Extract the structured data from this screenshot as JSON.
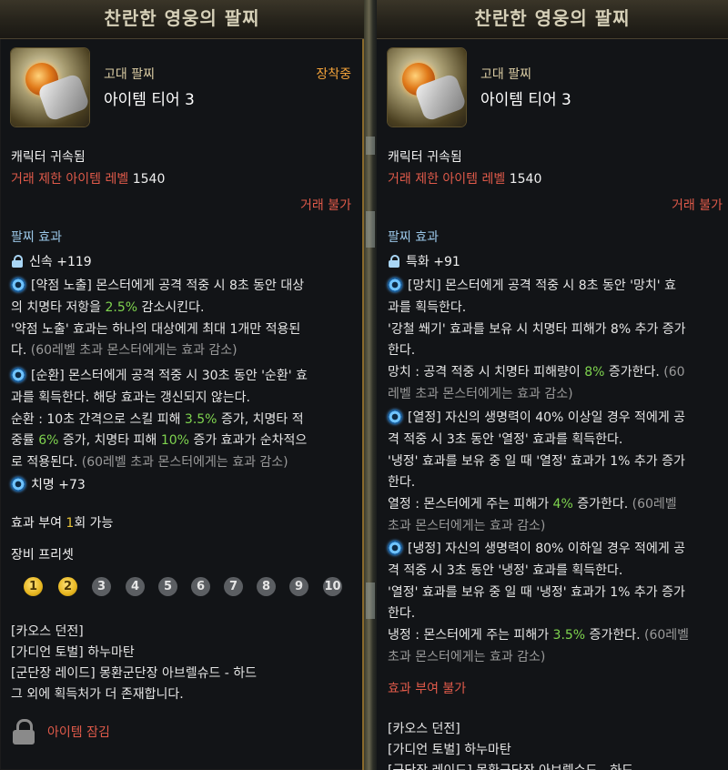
{
  "left": {
    "title": "찬란한 영웅의 팔찌",
    "grade": "고대 팔찌",
    "tier": "아이템 티어 3",
    "equipped": "장착중",
    "bound": "캐릭터 귀속됨",
    "trade_limit_label": "거래 제한 아이템 레벨",
    "trade_limit_value": "1540",
    "trade_status": "거래 불가",
    "effect_header": "팔찌 효과",
    "stat1": "신속 +119",
    "e1_line1": "[약점 노출] 몬스터에게 공격 적중 시 8초 동안 대상",
    "e1_line2a": "의 치명타 저항을 ",
    "e1_line2b": "2.5%",
    "e1_line2c": " 감소시킨다.",
    "e1_line3": "'약점 노출' 효과는 하나의 대상에게 최대 1개만 적용된",
    "e1_line4a": "다. ",
    "e1_line4b": "(60레벨 초과 몬스터에게는 효과 감소)",
    "e2_line1": "[순환] 몬스터에게 공격 적중 시 30초 동안 '순환' 효",
    "e2_line2": "과를 획득한다. 해당 효과는 갱신되지 않는다.",
    "e2_line3a": "순환 : 10초 간격으로 스킬 피해 ",
    "e2_line3b": "3.5%",
    "e2_line3c": " 증가, 치명타 적",
    "e2_line4a": "중률 ",
    "e2_line4b": "6%",
    "e2_line4c": " 증가, 치명타 피해 ",
    "e2_line4d": "10%",
    "e2_line4e": " 증가 효과가 순차적으",
    "e2_line5a": "로 적용된다. ",
    "e2_line5b": "(60레벨 초과 몬스터에게는 효과 감소)",
    "stat2": "치명 +73",
    "grant_a": "효과 부여 ",
    "grant_b": "1",
    "grant_c": "회 가능",
    "preset_label": "장비 프리셋",
    "presets": [
      "1",
      "2",
      "3",
      "4",
      "5",
      "6",
      "7",
      "8",
      "9",
      "10"
    ],
    "source1": "[카오스 던전]",
    "source2": "[가디언 토벌] 하누마탄",
    "source3": "[군단장 레이드] 몽환군단장 아브렐슈드 - 하드",
    "source4": "그 외에 획득처가 더 존재합니다.",
    "lock_text": "아이템 잠김"
  },
  "right": {
    "title": "찬란한 영웅의 팔찌",
    "grade": "고대 팔찌",
    "tier": "아이템 티어 3",
    "bound": "캐릭터 귀속됨",
    "trade_limit_label": "거래 제한 아이템 레벨",
    "trade_limit_value": "1540",
    "trade_status": "거래 불가",
    "effect_header": "팔찌 효과",
    "stat1": "특화 +91",
    "e1_line1": "[망치] 몬스터에게 공격 적중 시 8초 동안 '망치' 효",
    "e1_line2": "과를 획득한다.",
    "e1_line3": "'강철 쐐기' 효과를 보유 시 치명타 피해가 8% 추가 증가",
    "e1_line4": "한다.",
    "e1_line5a": "망치 : 공격 적중 시 치명타 피해량이 ",
    "e1_line5b": "8%",
    "e1_line5c": " 증가한다. ",
    "e1_line5d": "(60",
    "e1_line6": "레벨 초과 몬스터에게는 효과 감소)",
    "e2_line1": "[열정] 자신의 생명력이 40% 이상일 경우 적에게 공",
    "e2_line2": "격 적중 시 3초 동안 '열정' 효과를 획득한다.",
    "e2_line3": "'냉정' 효과를 보유 중 일 때 '열정' 효과가 1% 추가 증가",
    "e2_line4": "한다.",
    "e2_line5a": "열정 : 몬스터에게 주는 피해가 ",
    "e2_line5b": "4%",
    "e2_line5c": " 증가한다. ",
    "e2_line5d": "(60레벨",
    "e2_line6": "초과 몬스터에게는 효과 감소)",
    "e3_line1": "[냉정] 자신의 생명력이 80% 이하일 경우 적에게 공",
    "e3_line2": "격 적중 시 3초 동안 '냉정' 효과를 획득한다.",
    "e3_line3": "'열정' 효과를 보유 중 일 때 '냉정' 효과가 1% 추가 증가",
    "e3_line4": "한다.",
    "e3_line5a": "냉정 : 몬스터에게 주는 피해가 ",
    "e3_line5b": "3.5%",
    "e3_line5c": " 증가한다. ",
    "e3_line5d": "(60레벨",
    "e3_line6": "초과 몬스터에게는 효과 감소)",
    "grant": "효과 부여 불가",
    "source1": "[카오스 던전]",
    "source2": "[가디언 토벌] 하누마탄",
    "source3": "[군단장 레이드] 몽환군단장 아브렐슈드 - 하드"
  }
}
